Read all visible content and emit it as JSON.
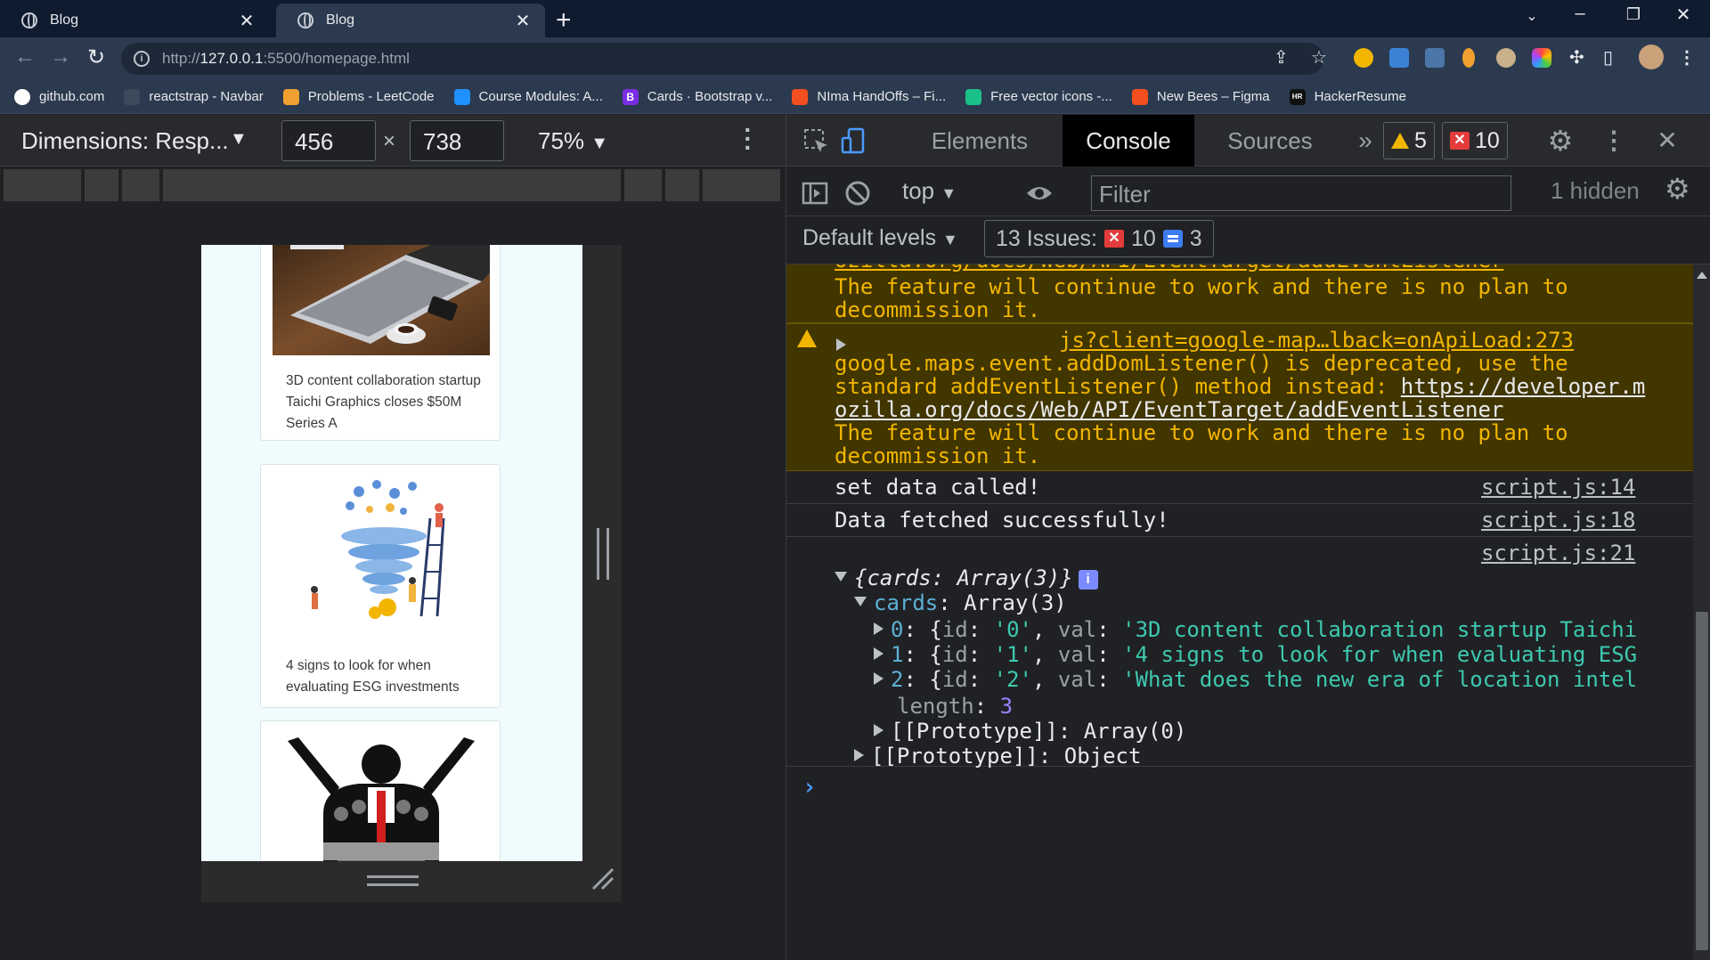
{
  "browser": {
    "tabs": [
      {
        "title": "Blog",
        "active": false
      },
      {
        "title": "Blog",
        "active": true
      }
    ],
    "url_prefix": "http://",
    "url_host": "127.0.0.1",
    "url_rest": ":5500/homepage.html",
    "bookmarks": [
      {
        "label": "github.com",
        "icon": "github-icon",
        "color": "#ffffff"
      },
      {
        "label": "reactstrap - Navbar",
        "icon": "reactstrap-icon",
        "color": "#3c4a5c"
      },
      {
        "label": "Problems - LeetCode",
        "icon": "leetcode-icon",
        "color": "#f0a030"
      },
      {
        "label": "Course Modules: A...",
        "icon": "cloud-icon",
        "color": "#1e90ff"
      },
      {
        "label": "Cards · Bootstrap v...",
        "icon": "bootstrap-icon",
        "color": "#7a2de3"
      },
      {
        "label": "NIma HandOffs – Fi...",
        "icon": "figma-icon",
        "color": "#f24e1e"
      },
      {
        "label": "Free vector icons -...",
        "icon": "freepik-icon",
        "color": "#1bbf8a"
      },
      {
        "label": "New Bees – Figma",
        "icon": "figma-icon",
        "color": "#f24e1e"
      },
      {
        "label": "HackerResume",
        "icon": "hackerresume-icon",
        "color": "#111111"
      }
    ]
  },
  "device_toolbar": {
    "dimensions_label": "Dimensions: Resp...",
    "width": "456",
    "height": "738",
    "zoom": "75%"
  },
  "page": {
    "cards": [
      {
        "text": "3D content collaboration startup Taichi Graphics closes $50M Series A",
        "image": "laptop-on-desk-image"
      },
      {
        "text": "4 signs to look for when evaluating ESG investments",
        "image": "funnel-illustration-image"
      },
      {
        "text": "",
        "image": "speaker-podium-image"
      }
    ]
  },
  "devtools": {
    "tabs": [
      "Elements",
      "Console",
      "Sources"
    ],
    "active_tab": "Console",
    "warnings_count": "5",
    "errors_count": "10",
    "context": "top",
    "filter_placeholder": "Filter",
    "hidden": "1 hidden",
    "levels": "Default levels",
    "issues_label": "13 Issues:",
    "issues_errors": "10",
    "issues_info": "3",
    "messages": {
      "warn1_tail": "ozilla.org/docs/Web/API/EventTarget/addEventListener",
      "warn1_line2": "The feature will continue to work and there is no plan to",
      "warn1_line3": "decommission it.",
      "warn2_source": "js?client=google-map…lback=onApiLoad:273",
      "warn2_line1": "google.maps.event.addDomListener() is deprecated, use the",
      "warn2_line2a": "standard addEventListener() method instead: ",
      "warn2_line2b": "https://developer.m",
      "warn2_line3": "ozilla.org/docs/Web/API/EventTarget/addEventListener",
      "warn2_line4": "The feature will continue to work and there is no plan to",
      "warn2_line5": "decommission it.",
      "log1_text": "set data called!",
      "log1_source": "script.js:14",
      "log2_text": "Data fetched successfully!",
      "log2_source": "script.js:18",
      "log3_source": "script.js:21",
      "obj_summary": "{cards: Array(3)}",
      "cards_key": "cards",
      "cards_val": "Array(3)",
      "items": [
        {
          "index": "0",
          "id": "'0'",
          "val": "'3D content collaboration startup Taichi"
        },
        {
          "index": "1",
          "id": "'1'",
          "val": "'4 signs to look for when evaluating ESG"
        },
        {
          "index": "2",
          "id": "'2'",
          "val": "'What does the new era of location intel"
        }
      ],
      "length_key": "length",
      "length_val": "3",
      "proto_array": "[[Prototype]]: Array(0)",
      "proto_object": "[[Prototype]]: Object"
    }
  }
}
